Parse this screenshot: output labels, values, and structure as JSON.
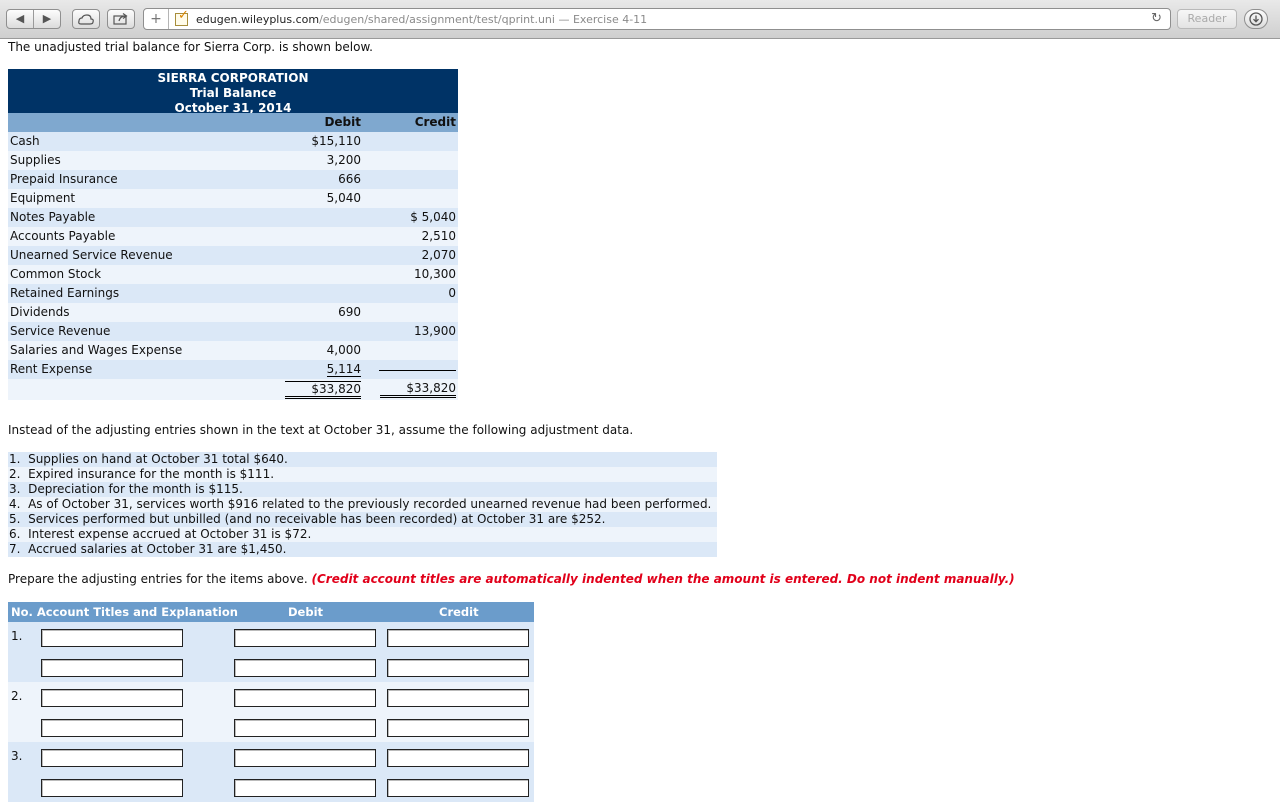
{
  "browser": {
    "nav_back": "◀",
    "nav_forward": "▶",
    "plus": "+",
    "url_host": "edugen.wileyplus.com",
    "url_path": "/edugen/shared/assignment/test/qprint.uni",
    "page_title_suffix": " — Exercise 4-11",
    "reader_label": "Reader"
  },
  "intro_text": "The unadjusted trial balance for Sierra Corp. is shown below.",
  "trial_balance": {
    "company": "SIERRA CORPORATION",
    "title": "Trial Balance",
    "date": "October 31, 2014",
    "col_debit": "Debit",
    "col_credit": "Credit",
    "rows": [
      {
        "account": "Cash",
        "debit": "$15,110",
        "credit": ""
      },
      {
        "account": "Supplies",
        "debit": "3,200",
        "credit": ""
      },
      {
        "account": "Prepaid Insurance",
        "debit": "666",
        "credit": ""
      },
      {
        "account": "Equipment",
        "debit": "5,040",
        "credit": ""
      },
      {
        "account": "Notes Payable",
        "debit": "",
        "credit": "$ 5,040"
      },
      {
        "account": "Accounts Payable",
        "debit": "",
        "credit": "2,510"
      },
      {
        "account": "Unearned Service Revenue",
        "debit": "",
        "credit": "2,070"
      },
      {
        "account": "Common Stock",
        "debit": "",
        "credit": "10,300"
      },
      {
        "account": "Retained Earnings",
        "debit": "",
        "credit": "0"
      },
      {
        "account": "Dividends",
        "debit": "690",
        "credit": ""
      },
      {
        "account": "Service Revenue",
        "debit": "",
        "credit": "13,900"
      },
      {
        "account": "Salaries and Wages Expense",
        "debit": "4,000",
        "credit": ""
      },
      {
        "account": "Rent Expense",
        "debit": "5,114",
        "credit": ""
      }
    ],
    "total_debit": "$33,820",
    "total_credit": "$33,820"
  },
  "instead_text": "Instead of the adjusting entries shown in the text at October 31, assume the following adjustment data.",
  "adjustments": [
    "1.  Supplies on hand at October 31 total $640.",
    "2.  Expired insurance for the month is $111.",
    "3.  Depreciation for the month is $115.",
    "4.  As of October 31, services worth $916 related to the previously recorded unearned revenue had been performed.",
    "5.  Services performed but unbilled (and no receivable has been recorded) at October 31 are $252.",
    "6.  Interest expense accrued at October 31 is $72.",
    "7.  Accrued salaries at October 31 are $1,450."
  ],
  "prepare_text": "Prepare the adjusting entries for the items above. ",
  "prepare_note": "(Credit account titles are automatically indented when the amount is entered. Do not indent manually.)",
  "answer_table": {
    "col_no_title": "No.  Account Titles and Explanation",
    "col_debit": "Debit",
    "col_credit": "Credit",
    "entries": [
      "1.",
      "2.",
      "3."
    ]
  }
}
